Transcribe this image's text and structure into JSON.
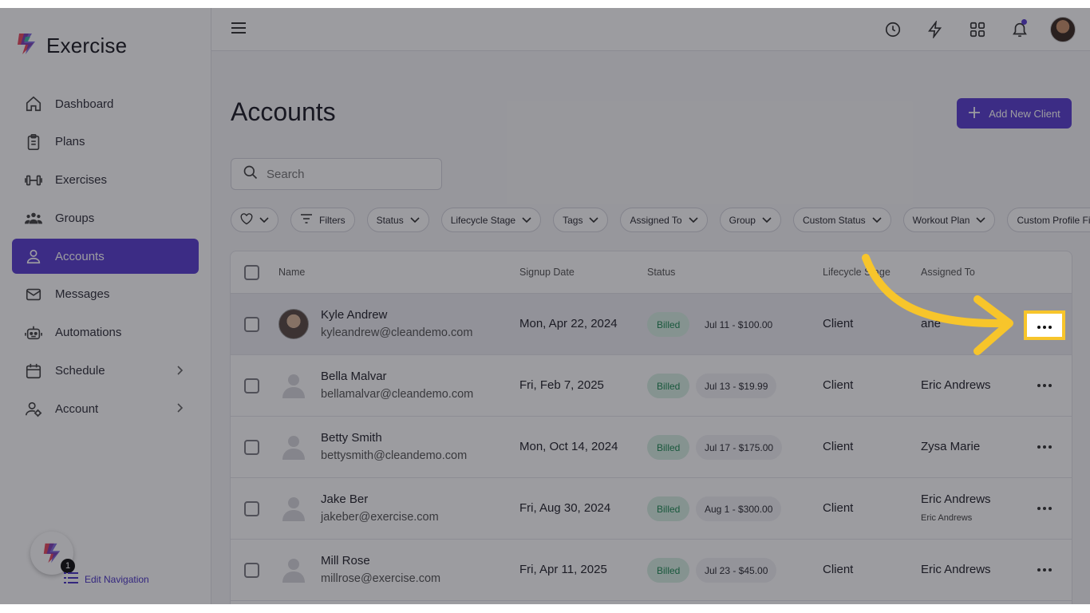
{
  "app": {
    "name": "Exercise"
  },
  "sidebar": {
    "items": [
      {
        "label": "Dashboard",
        "icon": "home-icon",
        "active": false,
        "chevron": false
      },
      {
        "label": "Plans",
        "icon": "clipboard-icon",
        "active": false,
        "chevron": false
      },
      {
        "label": "Exercises",
        "icon": "dumbbell-icon",
        "active": false,
        "chevron": false
      },
      {
        "label": "Groups",
        "icon": "group-icon",
        "active": false,
        "chevron": false
      },
      {
        "label": "Accounts",
        "icon": "user-icon",
        "active": true,
        "chevron": false
      },
      {
        "label": "Messages",
        "icon": "mail-icon",
        "active": false,
        "chevron": false
      },
      {
        "label": "Automations",
        "icon": "robot-icon",
        "active": false,
        "chevron": false
      },
      {
        "label": "Schedule",
        "icon": "calendar-icon",
        "active": false,
        "chevron": true
      },
      {
        "label": "Account",
        "icon": "user-gear-icon",
        "active": false,
        "chevron": true
      }
    ],
    "badge_count": "1",
    "edit_navigation": "Edit Navigation"
  },
  "topbar": {
    "icons": [
      "history-icon",
      "lightning-icon",
      "apps-grid-icon",
      "bell-icon"
    ]
  },
  "main": {
    "title": "Accounts",
    "add_button": "Add New Client",
    "search_placeholder": "Search",
    "filters": [
      "Filters",
      "Status",
      "Lifecycle Stage",
      "Tags",
      "Assigned To",
      "Group",
      "Custom Status",
      "Workout Plan",
      "Custom Profile Field"
    ]
  },
  "table": {
    "headers": {
      "name": "Name",
      "signup": "Signup Date",
      "status": "Status",
      "lifecycle": "Lifecycle Stage",
      "assigned": "Assigned To"
    },
    "rows": [
      {
        "name": "Kyle Andrew",
        "email": "kyleandrew@cleandemo.com",
        "signup": "Mon, Apr 22, 2024",
        "status": "Billed",
        "payment": "Jul 11 - $100.00",
        "lifecycle": "Client",
        "assigned": "ane",
        "assigned_sub": "",
        "photo": true
      },
      {
        "name": "Bella Malvar",
        "email": "bellamalvar@cleandemo.com",
        "signup": "Fri, Feb 7, 2025",
        "status": "Billed",
        "payment": "Jul 13 - $19.99",
        "lifecycle": "Client",
        "assigned": "Eric Andrews",
        "assigned_sub": "",
        "photo": false
      },
      {
        "name": "Betty Smith",
        "email": "bettysmith@cleandemo.com",
        "signup": "Mon, Oct 14, 2024",
        "status": "Billed",
        "payment": "Jul 17 - $175.00",
        "lifecycle": "Client",
        "assigned": "Zysa Marie",
        "assigned_sub": "",
        "photo": false
      },
      {
        "name": "Jake Ber",
        "email": "jakeber@exercise.com",
        "signup": "Fri, Aug 30, 2024",
        "status": "Billed",
        "payment": "Aug 1 - $300.00",
        "lifecycle": "Client",
        "assigned": "Eric Andrews",
        "assigned_sub": "Eric Andrews",
        "photo": false
      },
      {
        "name": "Mill Rose",
        "email": "millrose@exercise.com",
        "signup": "Fri, Apr 11, 2025",
        "status": "Billed",
        "payment": "Jul 23 - $45.00",
        "lifecycle": "Client",
        "assigned": "Eric Andrews",
        "assigned_sub": "",
        "photo": false
      }
    ]
  },
  "colors": {
    "accent": "#5b3fd1",
    "billed_bg": "#d7f0e3",
    "billed_text": "#1f8a55",
    "highlight": "#f7c52b"
  }
}
